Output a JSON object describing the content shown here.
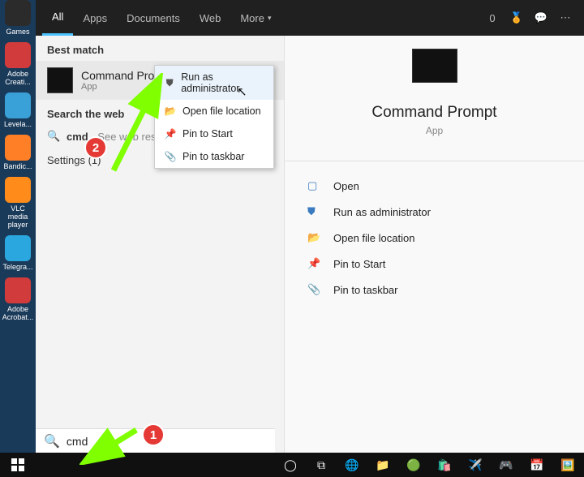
{
  "desktop_icons": [
    {
      "label": "Games",
      "color": "#2b2b2b"
    },
    {
      "label": "Adobe Creati...",
      "color": "#d23b3b"
    },
    {
      "label": "Levela...",
      "color": "#3aa0d8"
    },
    {
      "label": "Bandic...",
      "color": "#ff7f27"
    },
    {
      "label": "VLC media player",
      "color": "#ff8c1a"
    },
    {
      "label": "Telegra...",
      "color": "#2ba7df"
    },
    {
      "label": "Adobe Acrobat...",
      "color": "#d23b3b"
    }
  ],
  "tabs": {
    "items": [
      "All",
      "Apps",
      "Documents",
      "Web",
      "More"
    ],
    "active_index": 0
  },
  "header_right": {
    "count": "0"
  },
  "left": {
    "best_match_title": "Best match",
    "best_match": {
      "title": "Command Prompt",
      "subtitle": "App"
    },
    "search_web_title": "Search the web",
    "web_row": {
      "bold": "cmd",
      "rest": " - See web results"
    },
    "settings_row": "Settings (1)"
  },
  "context_menu": [
    {
      "icon": "⛊",
      "label": "Run as administrator",
      "highlight": true
    },
    {
      "icon": "📂",
      "label": "Open file location",
      "highlight": false
    },
    {
      "icon": "📌",
      "label": "Pin to Start",
      "highlight": false
    },
    {
      "icon": "📎",
      "label": "Pin to taskbar",
      "highlight": false
    }
  ],
  "detail": {
    "title": "Command Prompt",
    "subtitle": "App",
    "actions": [
      {
        "icon": "▢",
        "label": "Open"
      },
      {
        "icon": "⛊",
        "label": "Run as administrator"
      },
      {
        "icon": "📂",
        "label": "Open file location"
      },
      {
        "icon": "📌",
        "label": "Pin to Start"
      },
      {
        "icon": "📎",
        "label": "Pin to taskbar"
      }
    ]
  },
  "search": {
    "value": "cmd"
  },
  "annotations": {
    "badge1": "1",
    "badge2": "2"
  }
}
